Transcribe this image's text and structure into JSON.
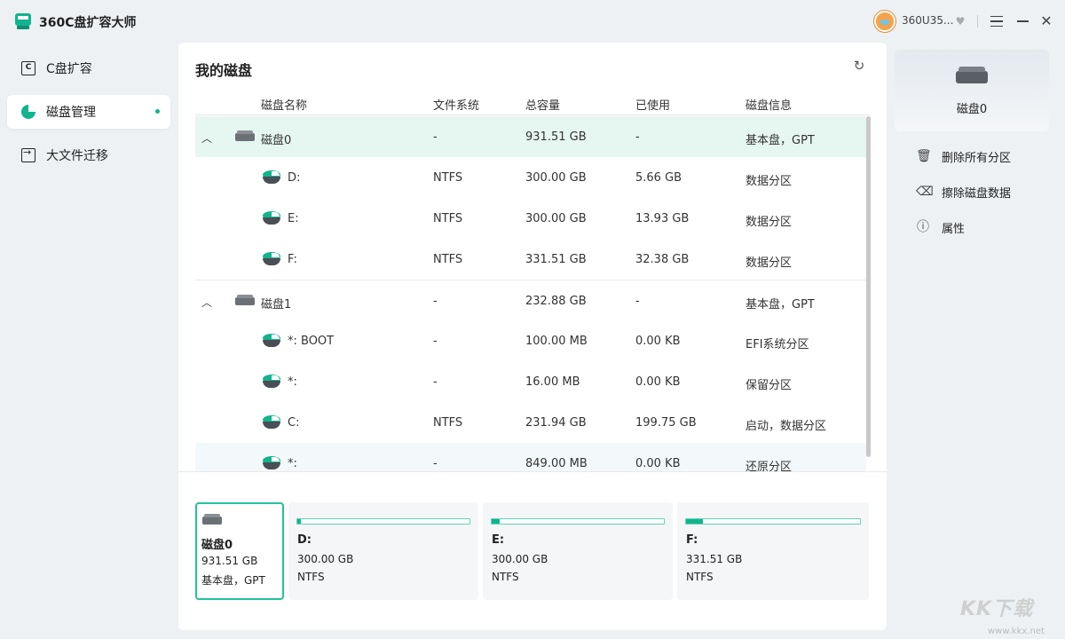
{
  "app": {
    "title": "360C盘扩容大师",
    "user_name": "360U35..."
  },
  "sidebar": {
    "items": [
      {
        "label": "C盘扩容",
        "icon": "c-drive-icon"
      },
      {
        "label": "磁盘管理",
        "icon": "pie-chart-icon",
        "active": true
      },
      {
        "label": "大文件迁移",
        "icon": "file-export-icon"
      }
    ]
  },
  "main": {
    "title": "我的磁盘",
    "columns": [
      "磁盘名称",
      "文件系统",
      "总容量",
      "已使用",
      "磁盘信息"
    ],
    "rows": [
      {
        "type": "disk",
        "name": "磁盘0",
        "fs": "-",
        "total": "931.51  GB",
        "used": "-",
        "info": "基本盘，GPT"
      },
      {
        "type": "part",
        "name": "D:",
        "fs": "NTFS",
        "total": "300.00  GB",
        "used": "5.66  GB",
        "info": "数据分区"
      },
      {
        "type": "part",
        "name": "E:",
        "fs": "NTFS",
        "total": "300.00  GB",
        "used": "13.93  GB",
        "info": "数据分区"
      },
      {
        "type": "part",
        "name": "F:",
        "fs": "NTFS",
        "total": "331.51  GB",
        "used": "32.38  GB",
        "info": "数据分区"
      },
      {
        "type": "disk",
        "name": "磁盘1",
        "fs": "-",
        "total": "232.88  GB",
        "used": "-",
        "info": "基本盘，GPT"
      },
      {
        "type": "part",
        "name": "*: BOOT",
        "fs": "-",
        "total": "100.00  MB",
        "used": "0.00 KB",
        "info": "EFI系统分区"
      },
      {
        "type": "part",
        "name": "*:",
        "fs": "-",
        "total": "16.00  MB",
        "used": "0.00 KB",
        "info": "保留分区"
      },
      {
        "type": "part",
        "name": "C:",
        "fs": "NTFS",
        "total": "231.94  GB",
        "used": "199.75  GB",
        "info": "启动，数据分区"
      },
      {
        "type": "part",
        "name": "*:",
        "fs": "-",
        "total": "849.00  MB",
        "used": "0.00 KB",
        "info": "还原分区"
      }
    ]
  },
  "cards": [
    {
      "title": "磁盘0",
      "line1": "931.51  GB",
      "line2": "基本盘，GPT",
      "kind": "disk"
    },
    {
      "title": "D:",
      "line1": "300.00  GB",
      "line2": "NTFS",
      "kind": "part",
      "usage": 0.019
    },
    {
      "title": "E:",
      "line1": "300.00  GB",
      "line2": "NTFS",
      "kind": "part",
      "usage": 0.046
    },
    {
      "title": "F:",
      "line1": "331.51  GB",
      "line2": "NTFS",
      "kind": "part",
      "usage": 0.098
    }
  ],
  "right_panel": {
    "disk_name": "磁盘0",
    "actions": [
      {
        "label": "删除所有分区",
        "icon": "trash-icon"
      },
      {
        "label": "擦除磁盘数据",
        "icon": "eraser-icon"
      },
      {
        "label": "属性",
        "icon": "info-icon"
      }
    ]
  },
  "watermark": {
    "text": "KK下载",
    "url": "www.kkx.net"
  }
}
